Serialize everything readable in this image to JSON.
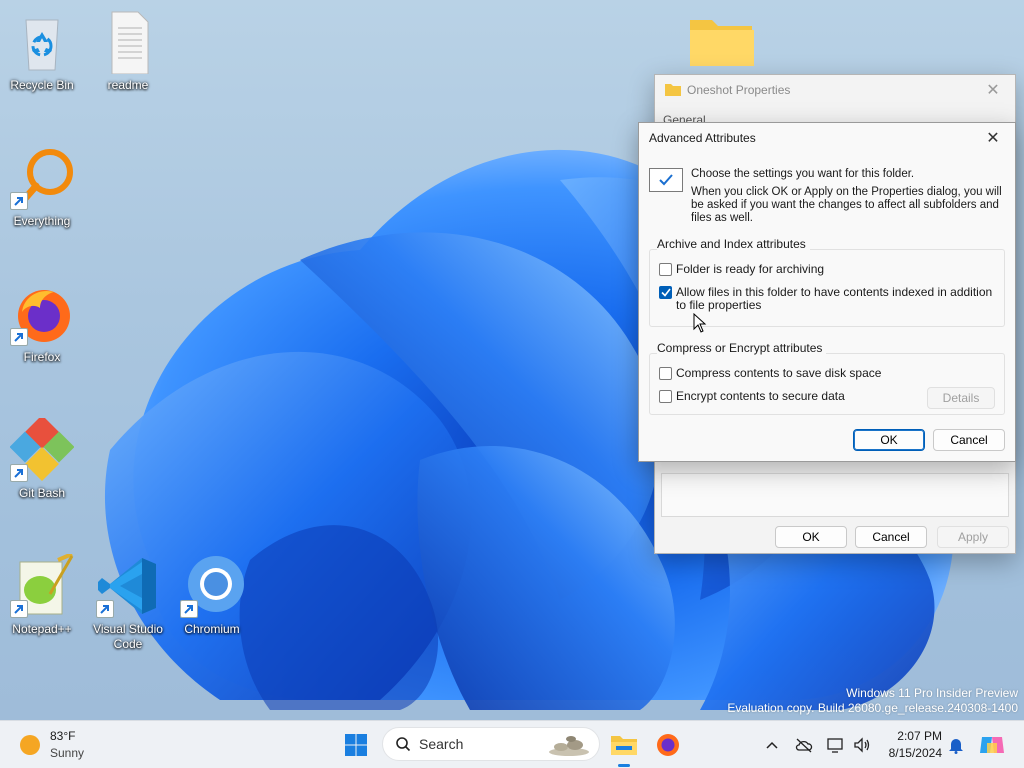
{
  "desktop": {
    "icons": [
      {
        "name": "Recycle Bin"
      },
      {
        "name": "readme"
      },
      {
        "name": "Everything"
      },
      {
        "name": "Firefox"
      },
      {
        "name": "Git Bash"
      },
      {
        "name": "Notepad++"
      },
      {
        "name": "Visual Studio Code"
      },
      {
        "name": "Chromium"
      }
    ],
    "watermark": {
      "line1": "Windows 11 Pro Insider Preview",
      "line2": "Evaluation copy. Build 26080.ge_release.240308-1400"
    }
  },
  "properties_window": {
    "title": "Oneshot Properties",
    "tab_first": "General",
    "ok_label": "OK",
    "cancel_label": "Cancel",
    "apply_label": "Apply"
  },
  "advanced_dialog": {
    "title": "Advanced Attributes",
    "intro_line1": "Choose the settings you want for this folder.",
    "intro_line2": "When you click OK or Apply on the Properties dialog, you will be asked if you want the changes to affect all subfolders and files as well.",
    "archive_group": {
      "title": "Archive and Index attributes",
      "options": [
        {
          "label": "Folder is ready for archiving",
          "checked": false
        },
        {
          "label": "Allow files in this folder to have contents indexed in addition to file properties",
          "checked": true
        }
      ]
    },
    "compress_group": {
      "title": "Compress or Encrypt attributes",
      "options": [
        {
          "label": "Compress contents to save disk space",
          "checked": false
        },
        {
          "label": "Encrypt contents to secure data",
          "checked": false
        }
      ],
      "details_label": "Details"
    },
    "ok_label": "OK",
    "cancel_label": "Cancel"
  },
  "taskbar": {
    "weather": {
      "temp": "83°F",
      "condition": "Sunny"
    },
    "search_placeholder": "Search",
    "clock": {
      "time": "2:07 PM",
      "date": "8/15/2024"
    }
  },
  "colors": {
    "accent": "#005fb8",
    "wallpaper_blue": "#1565e8"
  }
}
